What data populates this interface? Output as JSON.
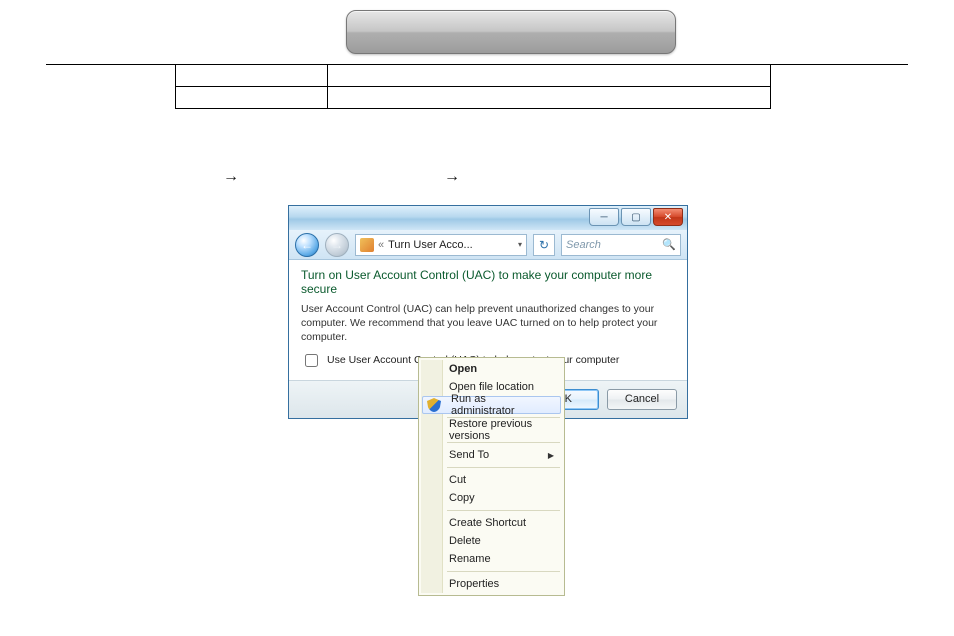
{
  "uac_window": {
    "breadcrumb": "Turn User Acco...",
    "search_placeholder": "Search",
    "heading": "Turn on User Account Control (UAC) to make your computer more secure",
    "body": "User Account Control (UAC) can help prevent unauthorized changes to your computer.  We recommend that you leave UAC turned on to help protect your computer.",
    "checkbox_label": "Use User Account Control (UAC) to help protect your computer",
    "ok_label": "OK",
    "cancel_label": "Cancel"
  },
  "context_menu": {
    "open": "Open",
    "open_file_location": "Open file location",
    "run_as_admin": "Run as administrator",
    "restore_prev": "Restore previous versions",
    "send_to": "Send To",
    "cut": "Cut",
    "copy": "Copy",
    "create_shortcut": "Create Shortcut",
    "delete": "Delete",
    "rename": "Rename",
    "properties": "Properties"
  }
}
